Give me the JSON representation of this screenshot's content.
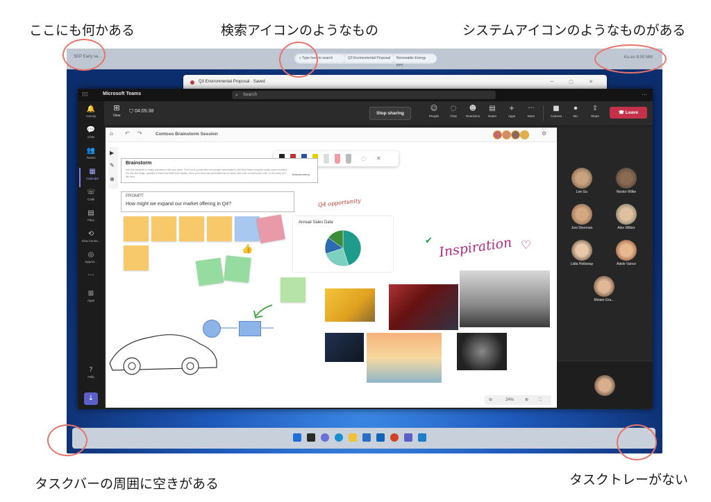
{
  "annotations": {
    "top_left": "ここにも何かある",
    "top_center": "検索アイコンのようなもの",
    "top_right": "システムアイコンのようなものがある",
    "bottom_left": "タスクバーの周囲に空きがある",
    "bottom_right": "タスクトレーがない"
  },
  "colors": {
    "annotation_circle": "#e8736b",
    "teams_accent": "#5b5fc7",
    "leave_red": "#c4314b"
  },
  "top_bar": {
    "app_title": "SEP Early sa...",
    "search_placeholder": "Type here to search",
    "tab_1": "Q3 Environmental Proposal",
    "tab_2": "Renewable Energy PPT",
    "system_area": "Ko-en 8:00 MM"
  },
  "document_window": {
    "title": "Q3 Environmental Proposal",
    "status": "Saved"
  },
  "teams": {
    "app_name": "Microsoft Teams",
    "search_placeholder": "Search",
    "more": "…",
    "rail": [
      {
        "icon": "bell-icon",
        "label": "Activity"
      },
      {
        "icon": "chat-icon",
        "label": "Chat"
      },
      {
        "icon": "teams-icon",
        "label": "Teams"
      },
      {
        "icon": "calendar-icon",
        "label": "Calendar"
      },
      {
        "icon": "phone-icon",
        "label": "Calls"
      },
      {
        "icon": "file-icon",
        "label": "Files"
      },
      {
        "icon": "viva-icon",
        "label": "Viva Conne..."
      },
      {
        "icon": "help-icon",
        "label": "Help"
      }
    ],
    "rail_extra": "Approv...",
    "rail_apps": "Apps",
    "meeting": {
      "view_label": "View",
      "timer": "04:05:38",
      "stop_sharing": "Stop sharing",
      "buttons": [
        {
          "icon": "people-icon",
          "label": "People"
        },
        {
          "icon": "chat-icon",
          "label": "Chat"
        },
        {
          "icon": "reactions-icon",
          "label": "Reactions"
        },
        {
          "icon": "notes-icon",
          "label": "Notes"
        },
        {
          "icon": "apps-icon",
          "label": "Apps"
        },
        {
          "icon": "more-icon",
          "label": "More"
        },
        {
          "icon": "camera-icon",
          "label": "Camera"
        },
        {
          "icon": "mic-icon",
          "label": "Mic"
        },
        {
          "icon": "share-icon",
          "label": "Share"
        }
      ],
      "leave": "Leave"
    },
    "whiteboard": {
      "title": "Contoso Brainstorm Session",
      "brainstorm_title": "Brainstorm",
      "brainstorm_text": "Use this template to easily brainstorm with your team. Fill in your prompt then encourage teammates to add their ideas using the sticky notes provided. For this first stage, quantity is more important than quality. Once your team has generated lots of ideas, take time to review and vote on the ideas you like best.",
      "brainstorm_tag": "Brainstorming",
      "prompt_label": "PROMPT:",
      "prompt_question": "How might we expand our market offering in Q4?",
      "q4_note": "Q4 opportunity",
      "inspiration": "Inspiration",
      "zoom_level": "24%"
    },
    "participants": [
      {
        "name": "Lee Gu"
      },
      {
        "name": "Nestor Wilke"
      },
      {
        "name": "Joni Sherman"
      },
      {
        "name": "Alex Wilber"
      },
      {
        "name": "Lidia Holloway"
      },
      {
        "name": "Adele Vance"
      },
      {
        "name": "Miriam Gra..."
      }
    ]
  },
  "chart_data": {
    "type": "pie",
    "title": "Annual Sales Data",
    "values": [
      45,
      25,
      15,
      15
    ],
    "colors": [
      "#1f9b8c",
      "#7bd0c0",
      "#2b6cb0",
      "#3c8c3c"
    ]
  }
}
